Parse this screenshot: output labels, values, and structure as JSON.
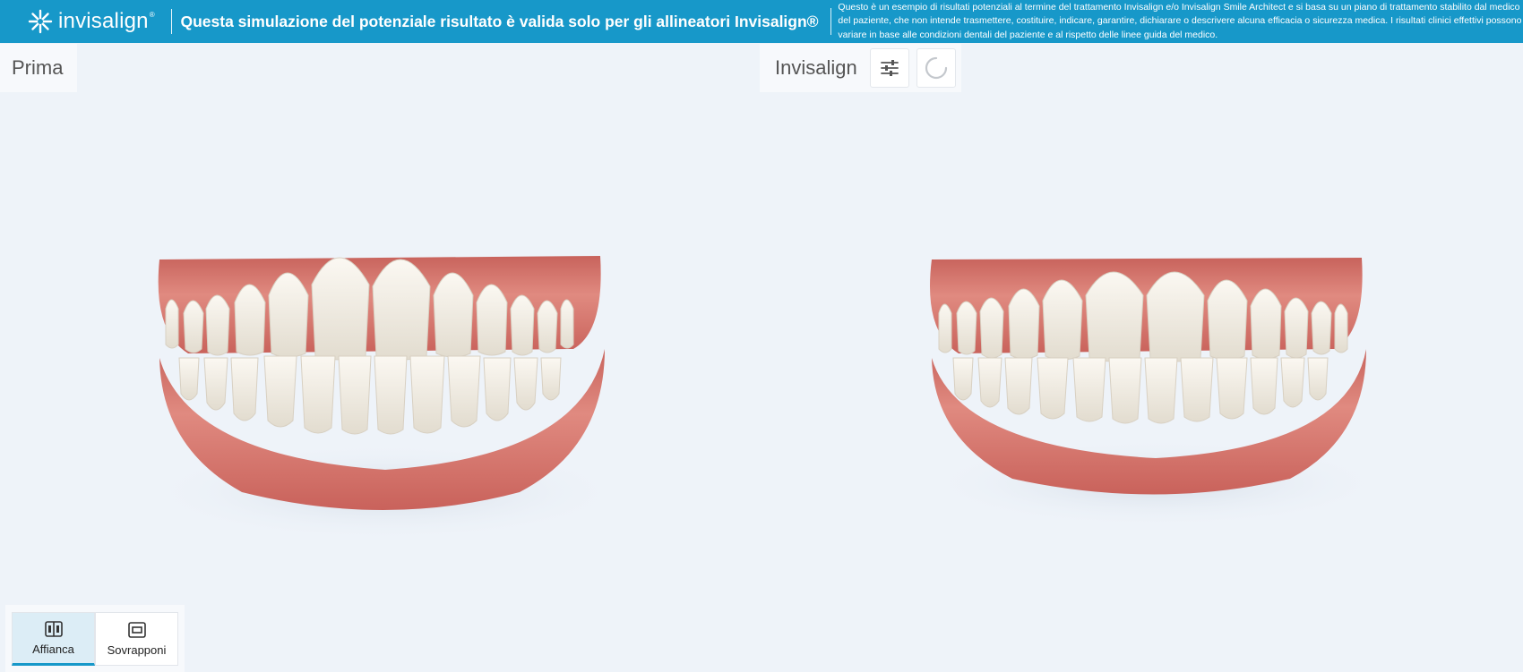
{
  "banner": {
    "logo_text": "invisalign",
    "logo_tm": "®",
    "headline": "Questa simulazione del potenziale risultato è valida solo per gli allineatori Invisalign®",
    "disclaimer": "Questo è un esempio di risultati potenziali al termine del trattamento Invisalign e/o Invisalign Smile Architect e si basa su un piano di trattamento stabilito dal medico del paziente, che non intende trasmettere, costituire, indicare, garantire, dichiarare o descrivere alcuna efficacia o sicurezza medica. I risultati clinici effettivi possono variare in base alle condizioni dentali del paziente e al rispetto delle linee guida del medico."
  },
  "views": {
    "left_label": "Prima",
    "right_label": "Invisalign"
  },
  "toolbar": {
    "settings_icon": "sliders-icon",
    "loading_icon": "spinner-icon"
  },
  "view_toggle": {
    "side_by_side_label": "Affianca",
    "overlay_label": "Sovrapponi",
    "active": "Affianca"
  },
  "colors": {
    "banner": "#1798c9",
    "background": "#eef3f9",
    "gum": "#d9786e",
    "tooth": "#f1ece2"
  }
}
